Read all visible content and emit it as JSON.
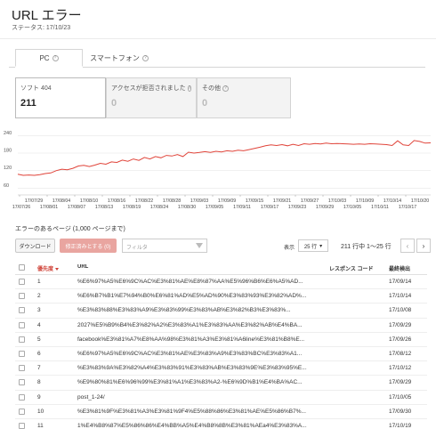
{
  "header": {
    "title": "URL エラー",
    "status": "ステータス: 17/10/23"
  },
  "tabs": [
    {
      "label": "PC",
      "active": true
    },
    {
      "label": "スマートフォン",
      "active": false
    }
  ],
  "cards": [
    {
      "label": "ソフト 404",
      "value": "211",
      "selected": true
    },
    {
      "label": "アクセスが拒否されました",
      "value": "0",
      "selected": false
    },
    {
      "label": "その他",
      "value": "0",
      "selected": false
    }
  ],
  "chart_data": {
    "type": "line",
    "color": "#e0443a",
    "y_ticks": [
      "240",
      "180",
      "120",
      "60"
    ],
    "ylim": [
      40,
      250
    ],
    "x_labels_top": [
      "17/07/29",
      "17/08/04",
      "17/08/10",
      "17/08/16",
      "17/08/22",
      "17/08/28",
      "17/09/03",
      "17/09/09",
      "17/09/15",
      "17/09/21",
      "17/09/27",
      "17/10/03",
      "17/10/09",
      "17/10/14",
      "17/10/20"
    ],
    "x_labels_bottom": [
      "17/07/26",
      "17/08/01",
      "17/08/07",
      "17/08/13",
      "17/08/19",
      "17/08/24",
      "17/08/30",
      "17/09/05",
      "17/09/11",
      "17/09/17",
      "17/09/23",
      "17/09/29",
      "17/10/05",
      "17/10/11",
      "17/10/17"
    ],
    "values": [
      108,
      104,
      105,
      104,
      106,
      110,
      112,
      120,
      125,
      123,
      128,
      136,
      138,
      134,
      139,
      145,
      142,
      150,
      148,
      156,
      152,
      160,
      155,
      165,
      160,
      168,
      164,
      172,
      170,
      175,
      168,
      183,
      180,
      182,
      185,
      182,
      186,
      184,
      188,
      186,
      190,
      188,
      192,
      196,
      200,
      205,
      208,
      206,
      209,
      205,
      210,
      206,
      212,
      210,
      213,
      211,
      214,
      212,
      213,
      212,
      211,
      210,
      211,
      210,
      212,
      211,
      210,
      209,
      206,
      222,
      208,
      206,
      223,
      220,
      214,
      215
    ]
  },
  "section": {
    "title": "エラーのあるページ (1,000 ページまで)"
  },
  "toolbar": {
    "download": "ダウンロード",
    "mark_fixed": "修正済みとする (0)",
    "filter_placeholder": "フィルタ",
    "show_label": "表示",
    "rows_select": "25 行",
    "rows_info": "211 行中 1〜25 行"
  },
  "table": {
    "headers": {
      "priority": "優先度",
      "url": "URL",
      "code": "レスポンス コード",
      "date": "最終検出"
    },
    "rows": [
      {
        "priority": "1",
        "url": "%E6%97%A5%E6%9C%AC%E3%81%AE%E8%87%AA%E5%96%B6%E6%A5%AD...",
        "code": "",
        "date": "17/09/14"
      },
      {
        "priority": "2",
        "url": "%E6%B7%B1%E7%94%B0%E6%81%AD%E5%AD%90%E3%83%93%E3%82%AD%...",
        "code": "",
        "date": "17/10/14"
      },
      {
        "priority": "3",
        "url": "%E3%83%88%E3%83%A9%E3%83%99%E3%83%AB%E3%82%B3%E3%83%...",
        "code": "",
        "date": "17/10/08"
      },
      {
        "priority": "4",
        "url": "2027%E5%B9%B4%E3%82%A2%E3%83%A1%E3%83%AA%E3%82%AB%E4%BA...",
        "code": "",
        "date": "17/09/29"
      },
      {
        "priority": "5",
        "url": "facebook%E3%81%A7%E8%AA%98%E3%81%A3%E3%81%A6line%E3%81%B8%E...",
        "code": "",
        "date": "17/09/26"
      },
      {
        "priority": "6",
        "url": "%E6%97%A5%E6%9C%AC%E3%81%AE%E3%83%A9%E3%83%BC%E3%83%A1...",
        "code": "",
        "date": "17/08/12"
      },
      {
        "priority": "7",
        "url": "%E3%83%9A%E3%82%A4%E3%83%91%E3%83%AB%E3%83%9E%E3%83%95%E...",
        "code": "",
        "date": "17/10/12"
      },
      {
        "priority": "8",
        "url": "%E9%80%81%E6%96%99%E3%81%A1%E3%83%A2-%E6%9D%B1%E4%BA%AC...",
        "code": "",
        "date": "17/09/29"
      },
      {
        "priority": "9",
        "url": "post_1-24/",
        "code": "",
        "date": "17/10/05"
      },
      {
        "priority": "10",
        "url": "%E3%81%9F%E3%81%A3%E3%81%9F4%E5%88%86%E3%81%AE%E5%86%B7%...",
        "code": "",
        "date": "17/09/30"
      },
      {
        "priority": "11",
        "url": "1%E4%B8%87%E5%86%86%E4%BB%A5%E4%B8%8B%E3%81%AEa4%E3%83%A...",
        "code": "",
        "date": "17/10/19"
      }
    ]
  }
}
